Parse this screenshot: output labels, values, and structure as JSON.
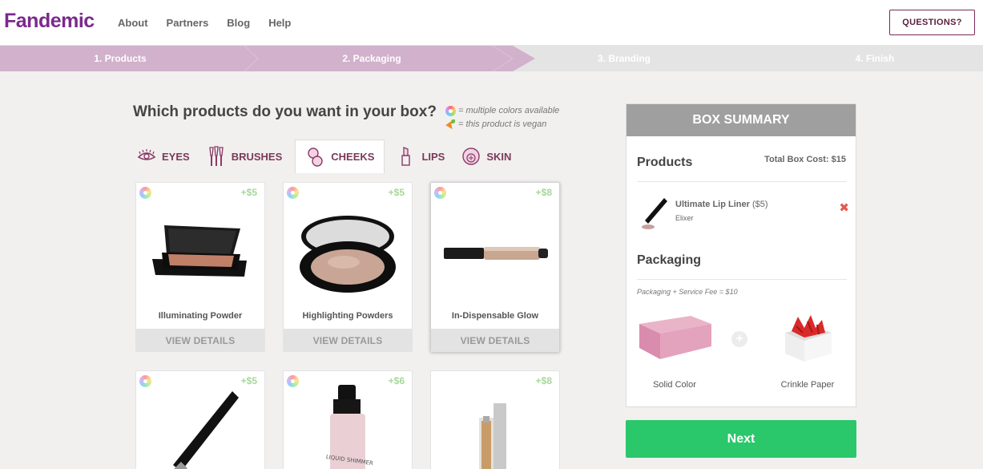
{
  "brand": {
    "logo": "Fandemic"
  },
  "nav": {
    "about": "About",
    "partners": "Partners",
    "blog": "Blog",
    "help": "Help",
    "questions": "QUESTIONS?"
  },
  "steps": [
    "1. Products",
    "2. Packaging",
    "3. Branding",
    "4. Finish"
  ],
  "main": {
    "heading": "Which products do you want in your box?",
    "legend_colors": "= multiple colors available",
    "legend_vegan": "= this product is vegan"
  },
  "tabs": [
    {
      "label": "EYES",
      "icon": "eye-icon"
    },
    {
      "label": "BRUSHES",
      "icon": "brushes-icon"
    },
    {
      "label": "CHEEKS",
      "icon": "cheeks-icon",
      "active": true
    },
    {
      "label": "LIPS",
      "icon": "lipstick-icon"
    },
    {
      "label": "SKIN",
      "icon": "skin-icon"
    }
  ],
  "products": [
    {
      "name": "Illuminating Powder",
      "price": "+$5",
      "details": "VIEW DETAILS"
    },
    {
      "name": "Highlighting Powders",
      "price": "+$5",
      "details": "VIEW DETAILS"
    },
    {
      "name": "In-Dispensable Glow",
      "price": "+$8",
      "details": "VIEW DETAILS"
    },
    {
      "name": "",
      "price": "+$5"
    },
    {
      "name": "",
      "price": "+$6",
      "tube_text": "LIQUID SHIMMER"
    },
    {
      "name": "",
      "price": "+$8"
    }
  ],
  "summary": {
    "title": "BOX SUMMARY",
    "products_title": "Products",
    "total": "Total Box Cost: $15",
    "item_name": "Ultimate Lip Liner",
    "item_price": "($5)",
    "item_brand": "Elixer",
    "remove": "✖",
    "packaging_title": "Packaging",
    "packaging_note": "Packaging + Service Fee = $10",
    "box_label": "Solid Color",
    "filler_label": "Crinkle Paper",
    "plus": "+"
  },
  "next": "Next",
  "colors": {
    "brand": "#7a2a8c",
    "step_active": "#d1b1cb",
    "next": "#2ac76b",
    "price": "#a8d69c"
  }
}
